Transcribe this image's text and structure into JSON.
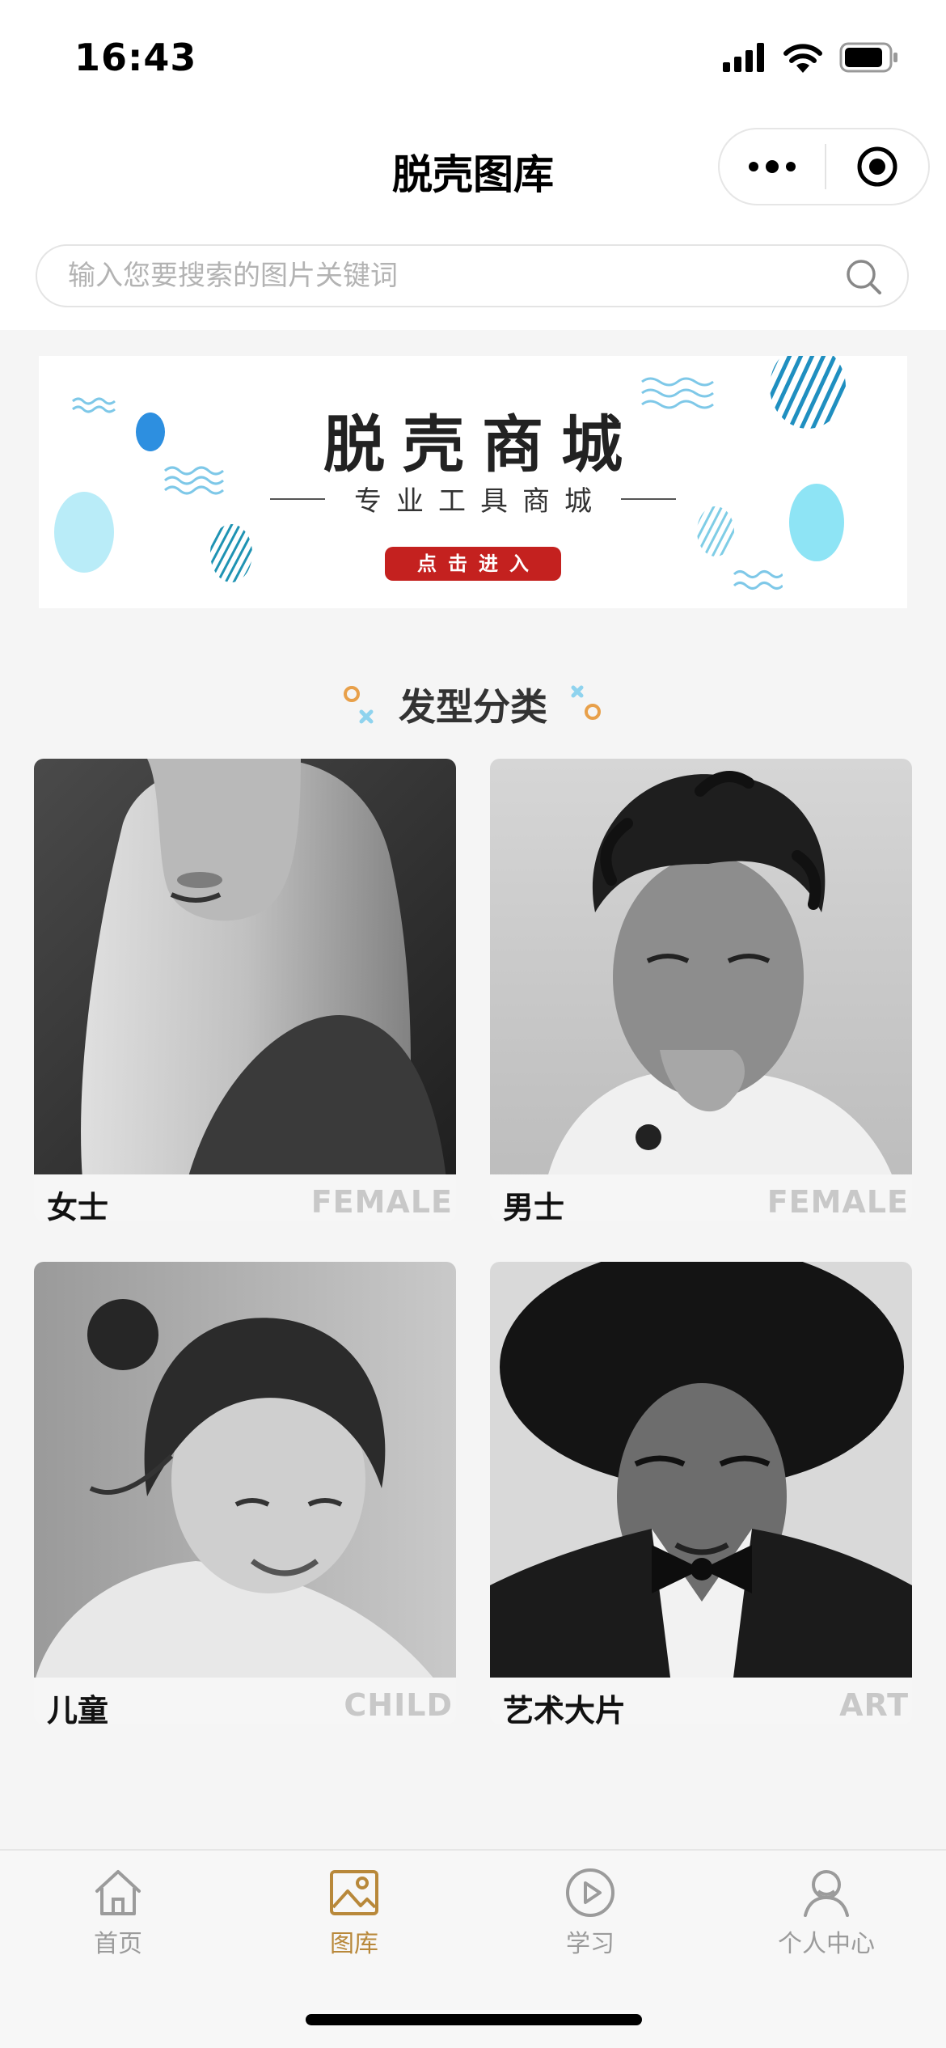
{
  "status_bar": {
    "time": "16:43"
  },
  "header": {
    "title": "脱壳图库",
    "capsule": {
      "more_icon": "more-dots-icon",
      "close_icon": "target-circle-icon"
    }
  },
  "search": {
    "placeholder": "输入您要搜索的图片关键词",
    "value": "",
    "icon": "search-icon"
  },
  "banner": {
    "title": "脱壳商城",
    "subtitle": "专业工具商城",
    "button_label": "点击进入",
    "button_color": "#c4211f"
  },
  "section": {
    "title": "发型分类"
  },
  "categories": [
    {
      "cn": "女士",
      "en": "FEMALE"
    },
    {
      "cn": "男士",
      "en": "FEMALE"
    },
    {
      "cn": "儿童",
      "en": "CHILD"
    },
    {
      "cn": "艺术大片",
      "en": "ART"
    }
  ],
  "tabbar": {
    "active_color": "#b8883a",
    "inactive_color": "#9b9b9b",
    "tabs": [
      {
        "label": "首页",
        "icon": "home-icon",
        "active": false
      },
      {
        "label": "图库",
        "icon": "gallery-icon",
        "active": true
      },
      {
        "label": "学习",
        "icon": "play-icon",
        "active": false
      },
      {
        "label": "个人中心",
        "icon": "user-icon",
        "active": false
      }
    ]
  }
}
